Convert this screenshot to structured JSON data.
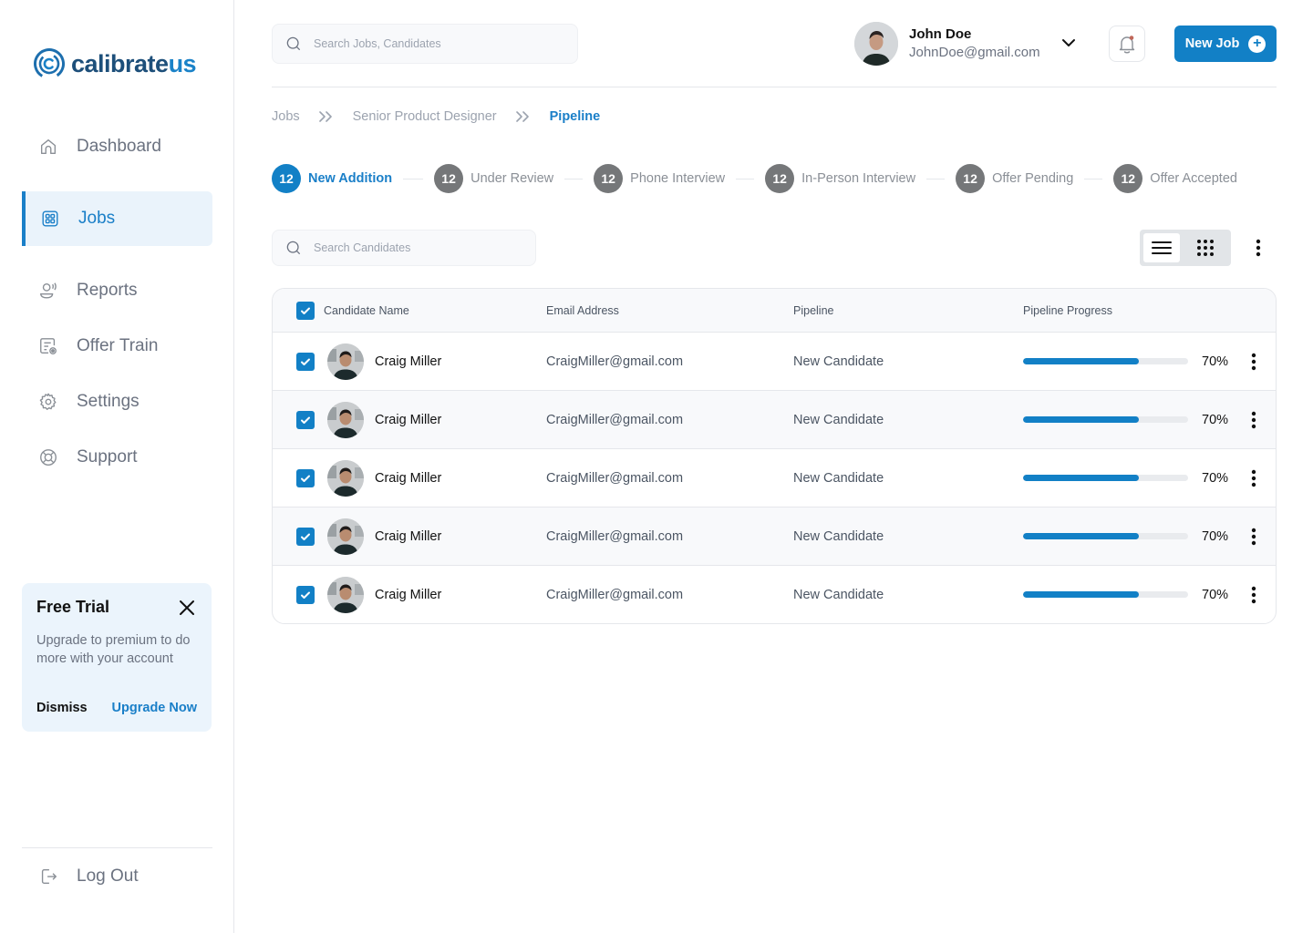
{
  "brand": {
    "name_main": "calibrate",
    "name_accent": "us",
    "primary_color": "#1280c6",
    "dark_color": "#1d4f7a"
  },
  "sidebar": {
    "items": [
      {
        "label": "Dashboard",
        "icon": "home-icon",
        "active": false
      },
      {
        "label": "Jobs",
        "icon": "grid-icon",
        "active": true
      },
      {
        "label": "Reports",
        "icon": "reports-icon",
        "active": false
      },
      {
        "label": "Offer Train",
        "icon": "offer-train-icon",
        "active": false
      },
      {
        "label": "Settings",
        "icon": "gear-icon",
        "active": false
      },
      {
        "label": "Support",
        "icon": "lifebuoy-icon",
        "active": false
      }
    ],
    "trial": {
      "title": "Free Trial",
      "body": "Upgrade to premium to do more with your account",
      "dismiss_label": "Dismiss",
      "upgrade_label": "Upgrade Now"
    },
    "logout_label": "Log Out"
  },
  "header": {
    "search_placeholder": "Search Jobs, Candidates",
    "user": {
      "name": "John Doe",
      "email": "JohnDoe@gmail.com"
    },
    "new_job_label": "New Job"
  },
  "breadcrumb": [
    "Jobs",
    "Senior Product Designer",
    "Pipeline"
  ],
  "stages": [
    {
      "count": "12",
      "label": "New Addition",
      "active": true
    },
    {
      "count": "12",
      "label": "Under Review",
      "active": false
    },
    {
      "count": "12",
      "label": "Phone Interview",
      "active": false
    },
    {
      "count": "12",
      "label": "In-Person Interview",
      "active": false
    },
    {
      "count": "12",
      "label": "Offer Pending",
      "active": false
    },
    {
      "count": "12",
      "label": "Offer Accepted",
      "active": false
    }
  ],
  "toolbar": {
    "search_placeholder": "Search Candidates",
    "view_mode": "list"
  },
  "table": {
    "columns": [
      "Candidate Name",
      "Email Address",
      "Pipeline",
      "Pipeline Progress"
    ],
    "all_selected": true,
    "rows": [
      {
        "name": "Craig Miller",
        "email": "CraigMiller@gmail.com",
        "pipeline": "New Candidate",
        "progress": 70,
        "progress_label": "70%",
        "selected": true
      },
      {
        "name": "Craig Miller",
        "email": "CraigMiller@gmail.com",
        "pipeline": "New Candidate",
        "progress": 70,
        "progress_label": "70%",
        "selected": true
      },
      {
        "name": "Craig Miller",
        "email": "CraigMiller@gmail.com",
        "pipeline": "New Candidate",
        "progress": 70,
        "progress_label": "70%",
        "selected": true
      },
      {
        "name": "Craig Miller",
        "email": "CraigMiller@gmail.com",
        "pipeline": "New Candidate",
        "progress": 70,
        "progress_label": "70%",
        "selected": true
      },
      {
        "name": "Craig Miller",
        "email": "CraigMiller@gmail.com",
        "pipeline": "New Candidate",
        "progress": 70,
        "progress_label": "70%",
        "selected": true
      }
    ]
  }
}
